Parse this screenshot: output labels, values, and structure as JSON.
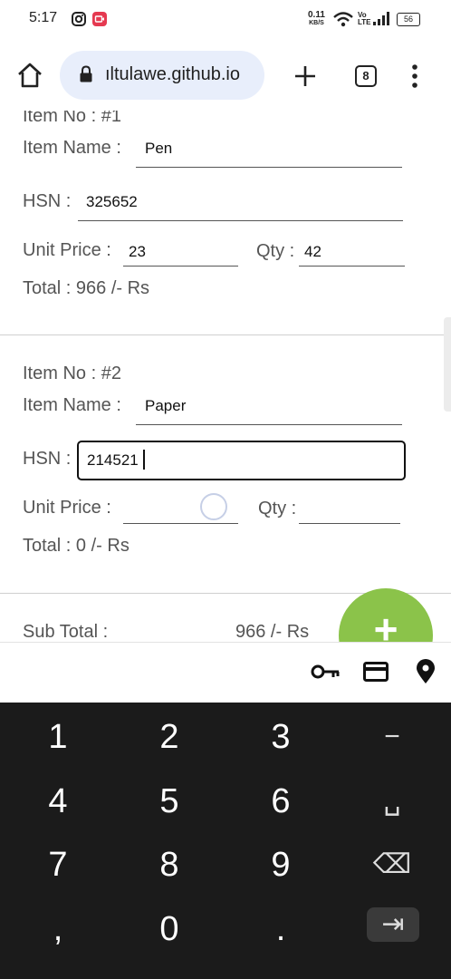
{
  "status_bar": {
    "time": "5:17",
    "net_speed_value": "0.11",
    "net_speed_unit": "KB/S",
    "volte_top": "Vo",
    "volte_bottom": "LTE",
    "battery": "56"
  },
  "browser": {
    "url": "ıltulawe.github.io",
    "tab_count": "8"
  },
  "items": [
    {
      "item_no": "Item No : #1",
      "name_label": "Item Name :",
      "name_value": "Pen",
      "hsn_label": "HSN :",
      "hsn_value": "325652",
      "unit_price_label": "Unit Price :",
      "unit_price_value": "23",
      "qty_label": "Qty :",
      "qty_value": "42",
      "total": "Total : 966 /- Rs"
    },
    {
      "item_no": "Item No : #2",
      "name_label": "Item Name :",
      "name_value": "Paper",
      "hsn_label": "HSN :",
      "hsn_value": "214521",
      "unit_price_label": "Unit Price :",
      "unit_price_value": "",
      "qty_label": "Qty :",
      "qty_value": "",
      "total": "Total : 0 /- Rs"
    }
  ],
  "subtotal": {
    "label": "Sub Total :",
    "value": "966 /- Rs"
  },
  "fab_label": "+",
  "autofill": {
    "icons": [
      "key-icon",
      "credit-card-icon",
      "location-pin-icon"
    ]
  },
  "keyboard": {
    "rows": [
      [
        "1",
        "2",
        "3",
        "−"
      ],
      [
        "4",
        "5",
        "6",
        "␣"
      ],
      [
        "7",
        "8",
        "9",
        "⌫"
      ],
      [
        ",",
        "0",
        ".",
        "⇥"
      ]
    ]
  },
  "colors": {
    "accent_fab": "#8bc34a",
    "url_pill": "#e8eefb",
    "keyboard_bg": "#1b1b1b"
  }
}
